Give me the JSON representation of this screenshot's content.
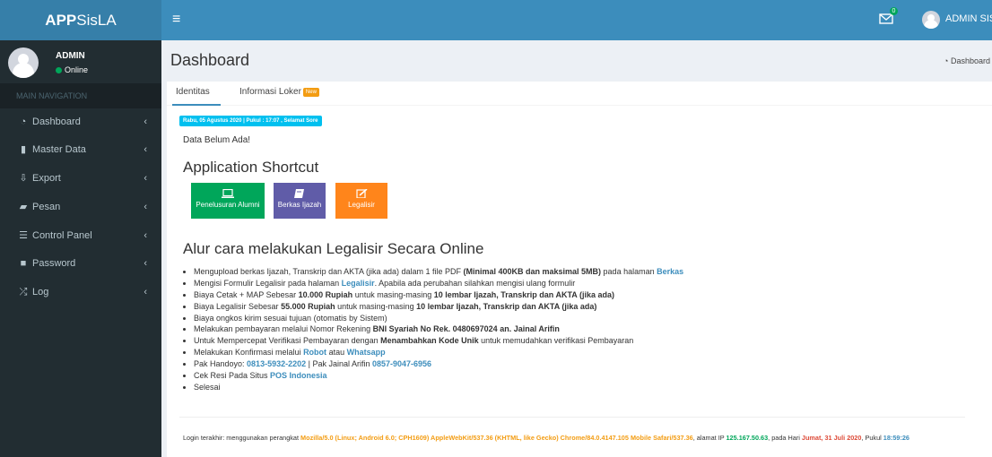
{
  "app": {
    "logo_bold": "APP",
    "logo_rest": "SisLA"
  },
  "navbar": {
    "menu_toggle": "≡",
    "mail_badge": "0",
    "username": "ADMIN SISLA"
  },
  "sidebar": {
    "user": {
      "name": "ADMIN",
      "status": "Online"
    },
    "header": "MAIN NAVIGATION",
    "items": [
      {
        "label": "Dashboard",
        "icon": "dashboard-icon"
      },
      {
        "label": "Master Data",
        "icon": "file-icon"
      },
      {
        "label": "Export",
        "icon": "export-icon"
      },
      {
        "label": "Pesan",
        "icon": "folder-icon"
      },
      {
        "label": "Control Panel",
        "icon": "list-icon"
      },
      {
        "label": "Password",
        "icon": "lock-icon"
      },
      {
        "label": "Log",
        "icon": "random-icon"
      }
    ]
  },
  "header": {
    "title": "Dashboard",
    "breadcrumb": "Dashboard"
  },
  "tabs": [
    {
      "label": "Identitas"
    },
    {
      "label": "Informasi Loker",
      "badge": "New"
    }
  ],
  "content": {
    "date_label": "Rabu, 05 Agustus 2020 | Pukul : 17:07 , Selamat Sore",
    "no_data": "Data Belum Ada!",
    "shortcut_title": "Application Shortcut",
    "shortcuts": [
      {
        "label": "Penelusuran Alumni",
        "color": "#00a65a",
        "icon": "laptop-icon"
      },
      {
        "label": "Berkas Ijazah",
        "color": "#605ca8",
        "icon": "book-icon"
      },
      {
        "label": "Legalisir",
        "color": "#ff851b",
        "icon": "edit-icon"
      }
    ],
    "alur_title": "Alur cara melakukan Legalisir Secara Online",
    "steps": {
      "s1a": "Mengupload berkas Ijazah, Transkrip dan AKTA (jika ada) dalam 1 file PDF ",
      "s1b": "(Minimal 400KB dan maksimal 5MB)",
      "s1c": " pada halaman ",
      "s1d": "Berkas",
      "s2a": "Mengisi Formulir Legalisir pada halaman ",
      "s2b": "Legalisir",
      "s2c": ". Apabila ada perubahan silahkan mengisi ulang formulir",
      "s3a": "Biaya Cetak + MAP Sebesar ",
      "s3b": "10.000 Rupiah",
      "s3c": " untuk masing-masing ",
      "s3d": "10 lembar Ijazah, Transkrip dan AKTA (jika ada)",
      "s4a": "Biaya Legalisir Sebesar ",
      "s4b": "55.000 Rupiah",
      "s4c": " untuk masing-masing ",
      "s4d": "10 lembar Ijazah, Transkrip dan AKTA (jika ada)",
      "s5": "Biaya ongkos kirim sesuai tujuan (otomatis by Sistem)",
      "s6a": "Melakukan pembayaran melalui Nomor Rekening ",
      "s6b": "BNI Syariah No Rek. 0480697024 an. Jainal Arifin",
      "s7a": "Untuk Mempercepat Verifikasi Pembayaran dengan ",
      "s7b": "Menambahkan Kode Unik",
      "s7c": " untuk memudahkan verifikasi Pembayaran",
      "s8a": "Melakukan Konfirmasi melalui ",
      "s8b": "Robot",
      "s8c": " atau ",
      "s8d": "Whatsapp",
      "s9a": "Pak Handoyo: ",
      "s9b": "0813-5932-2202",
      "s9c": " | Pak Jainal Arifin ",
      "s9d": "0857-9047-6956",
      "s10a": "Cek Resi Pada Situs ",
      "s10b": "POS Indonesia",
      "s11": "Selesai"
    },
    "login": {
      "prefix": "Login terakhir: menggunakan perangkat ",
      "agent": "Mozilla/5.0 (Linux; Android 6.0; CPH1609) AppleWebKit/537.36 (KHTML, like Gecko) Chrome/84.0.4147.105 Mobile Safari/537.36",
      "ip_label": ", alamat IP ",
      "ip": "125.167.50.63",
      "day_label": ", pada Hari ",
      "day": "Jumat, 31 Juli 2020",
      "time_label": ", Pukul ",
      "time": "18:59:26"
    }
  },
  "colors": {
    "navbar": "#3c8dbc",
    "logo": "#367fa9",
    "sidebar": "#222d32",
    "info": "#00c0ef"
  }
}
